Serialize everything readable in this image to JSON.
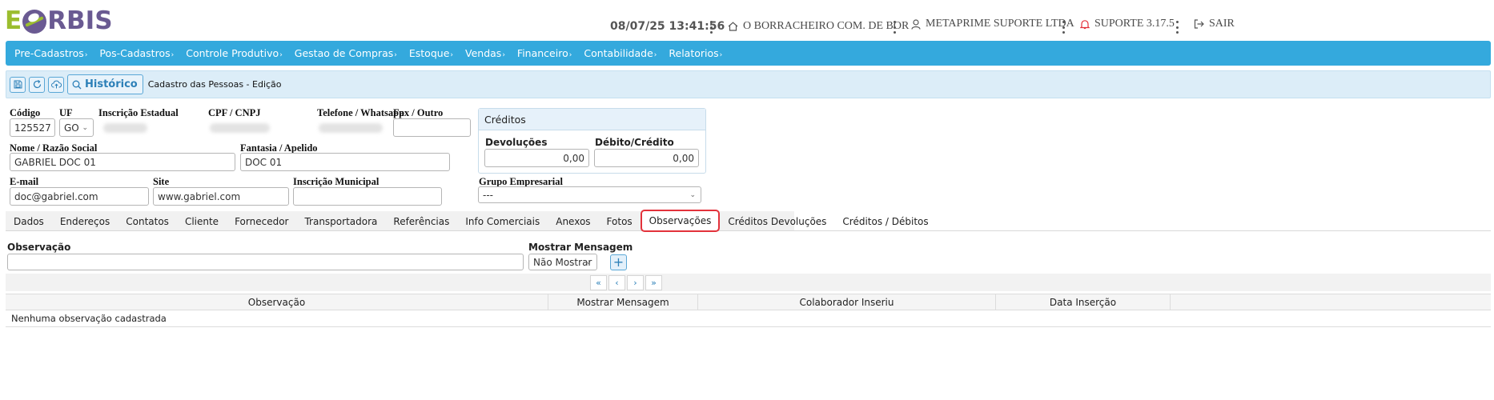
{
  "logo": {
    "text_e": "E",
    "text_rest": "RBIS"
  },
  "topbar": {
    "datetime": "08/07/25 13:41:56",
    "company": "O BORRACHEIRO COM. DE BOR",
    "user": "METAPRIME SUPORTE LTDA",
    "support": "SUPORTE 3.17.5",
    "logout": "SAIR"
  },
  "menu": [
    "Pre-Cadastros",
    "Pos-Cadastros",
    "Controle Produtivo",
    "Gestao de Compras",
    "Estoque",
    "Vendas",
    "Financeiro",
    "Contabilidade",
    "Relatorios"
  ],
  "toolbar": {
    "history_label": "Histórico",
    "breadcrumb": "Cadastro das Pessoas - Edição"
  },
  "form": {
    "codigo_label": "Código",
    "codigo_value": "125527",
    "uf_label": "UF",
    "uf_value": "GO",
    "ie_label": "Inscrição Estadual",
    "cpf_label": "CPF / CNPJ",
    "telefone_label": "Telefone / Whatsapp",
    "fax_label": "Fax / Outro",
    "fax_value": "",
    "nome_label": "Nome / Razão Social",
    "nome_value": "GABRIEL DOC 01",
    "fantasia_label": "Fantasia / Apelido",
    "fantasia_value": "DOC 01",
    "email_label": "E-mail",
    "email_value": "doc@gabriel.com",
    "site_label": "Site",
    "site_value": "www.gabriel.com",
    "im_label": "Inscrição Municipal",
    "im_value": "",
    "grupo_label": "Grupo Empresarial",
    "grupo_value": "---"
  },
  "credits": {
    "title": "Créditos",
    "devolucoes_label": "Devoluções",
    "devolucoes_value": "0,00",
    "debito_label": "Débito/Crédito",
    "debito_value": "0,00"
  },
  "tabs": [
    "Dados",
    "Endereços",
    "Contatos",
    "Cliente",
    "Fornecedor",
    "Transportadora",
    "Referências",
    "Info Comerciais",
    "Anexos",
    "Fotos",
    "Observações",
    "Créditos Devoluções",
    "Créditos / Débitos"
  ],
  "active_tab": "Observações",
  "observacao": {
    "label": "Observação",
    "value": "",
    "mostrar_label": "Mostrar Mensagem",
    "mostrar_value": "Não Mostrar",
    "add_symbol": "+"
  },
  "pager": {
    "first": "«",
    "prev": "‹",
    "next": "›",
    "last": "»"
  },
  "grid": {
    "columns": [
      "Observação",
      "Mostrar Mensagem",
      "Colaborador Inseriu",
      "Data Inserção",
      ""
    ],
    "empty_message": "Nenhuma observação cadastrada"
  },
  "colors": {
    "menu_bg": "#34a9dd",
    "toolbar_bg": "#dcedf8",
    "active_tab_border": "#e3323b",
    "logo_purple": "#6a5a92",
    "logo_green": "#9bbd2e"
  }
}
